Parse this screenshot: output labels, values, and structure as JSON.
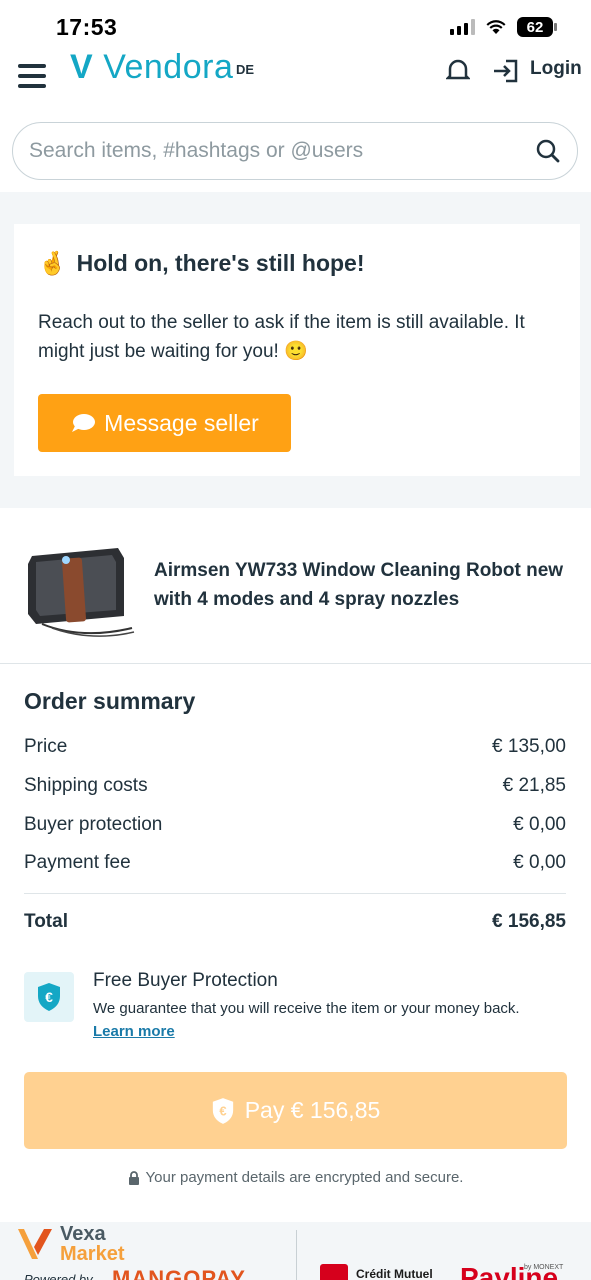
{
  "status_bar": {
    "time": "17:53",
    "battery": "62"
  },
  "header": {
    "brand": "Vendora",
    "brand_mark": "V",
    "region": "DE",
    "login_label": "Login"
  },
  "search": {
    "placeholder": "Search items, #hashtags or @users"
  },
  "hope": {
    "emoji": "🤞",
    "title": "Hold on, there's still hope!",
    "text": "Reach out to the seller to ask if the item is still available. It might just be waiting for you! 🙂",
    "button_label": "Message seller"
  },
  "product": {
    "title": "Airmsen YW733 Window Cleaning Robot new with 4 modes and 4 spray nozzles"
  },
  "summary": {
    "title": "Order summary",
    "rows": [
      {
        "label": "Price",
        "value": "€ 135,00"
      },
      {
        "label": "Shipping costs",
        "value": "€ 21,85"
      },
      {
        "label": "Buyer protection",
        "value": "€ 0,00"
      },
      {
        "label": "Payment fee",
        "value": "€ 0,00"
      }
    ],
    "total_label": "Total",
    "total_value": "€ 156,85"
  },
  "buyer_protection": {
    "title": "Free Buyer Protection",
    "text": "We guarantee that you will receive the item or your money back.",
    "link": "Learn more"
  },
  "pay_button": {
    "label": "Pay € 156,85"
  },
  "secure_note": "Your payment details are encrypted and secure.",
  "footer": {
    "vexa_line1": "Vexa",
    "vexa_line2": "Market",
    "powered_by": "Powered by",
    "mangopay": "MANGOPAY",
    "credit_mutuel": "Crédit Mutuel",
    "payline": "Payline",
    "payline_by": "by MONEXT"
  },
  "colors": {
    "accent": "#14a7c5",
    "orange": "#ffa114",
    "pay_disabled": "#ffd191",
    "text": "#21323d",
    "link": "#1a7aa8"
  }
}
